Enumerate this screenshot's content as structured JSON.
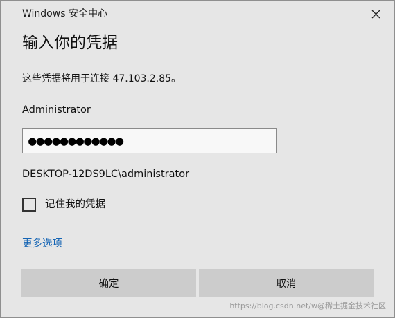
{
  "window": {
    "title": "Windows 安全中心",
    "close_icon": "close-icon"
  },
  "heading": "输入你的凭据",
  "message": "这些凭据将用于连接 47.103.2.85。",
  "username": "Administrator",
  "password": {
    "value": "●●●●●●●●●●●●"
  },
  "domain_user": "DESKTOP-12DS9LC\\administrator",
  "remember": {
    "label": "记住我的凭据",
    "checked": false
  },
  "more_options": "更多选项",
  "buttons": {
    "ok": "确定",
    "cancel": "取消"
  },
  "watermark": "https://blog.csdn.net/w@稀土掘金技术社区",
  "colors": {
    "dialog_bg": "#e6e6e6",
    "button_bg": "#cccccc",
    "link": "#1464b4"
  }
}
